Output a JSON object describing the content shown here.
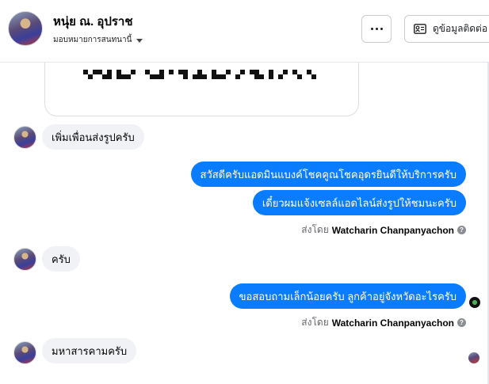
{
  "header": {
    "contact_name": "หนุ่ย ณ. อุปราช",
    "assign_label": "มอบหมายการสนทนานี้",
    "more_label": "More",
    "contact_info_label": "ดูข้อมูลติดต่อ"
  },
  "messages": [
    {
      "direction": "in",
      "text": "เพิ่มเพื่อนส่งรูปครับ"
    },
    {
      "direction": "out",
      "text": "สวัสดีครับแอดมินแบงค์โชคคูณโชคอุดรยินดีให้บริการครับ"
    },
    {
      "direction": "out",
      "text": "เดี๋ยวผมแจ้งเซลล์แอดไลน์ส่งรูปให้ชมนะครับ"
    },
    {
      "direction": "meta",
      "prefix": "ส่งโดย",
      "sender": "Watcharin Chanpanyachon"
    },
    {
      "direction": "in",
      "text": "ครับ"
    },
    {
      "direction": "out",
      "text": "ขอสอบถามเล็กน้อยครับ ลูกค้าอยู่จังหวัดอะไรครับ"
    },
    {
      "direction": "meta",
      "prefix": "ส่งโดย",
      "sender": "Watcharin Chanpanyachon"
    },
    {
      "direction": "in",
      "text": "มหาสารคามครับ"
    }
  ],
  "help_glyph": "?",
  "colors": {
    "outgoing_bubble": "#0a7cff",
    "incoming_bubble": "#f0f2f5",
    "meta_text": "#65676b"
  }
}
